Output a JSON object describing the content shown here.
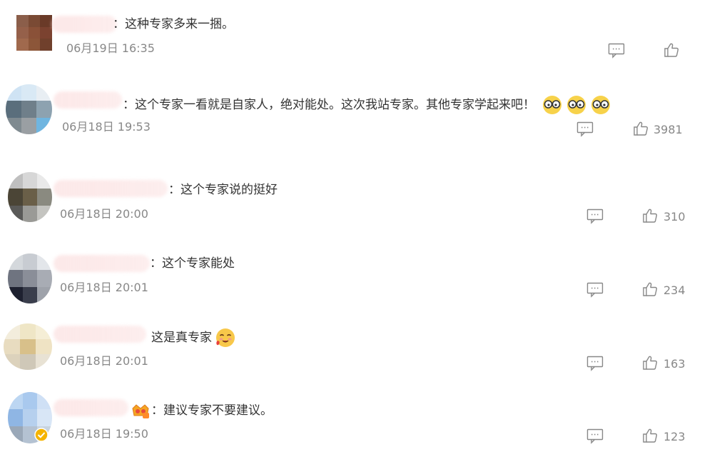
{
  "comments": [
    {
      "text": "：这种专家多来一捆。",
      "time": "06月19日 16:35",
      "likes": "",
      "colors": [
        "#8b5e4a",
        "#7a4a34",
        "#6a3a28",
        "#95604a",
        "#8a5138",
        "#7b4230",
        "#a0694d",
        "#8c5639",
        "#70402c"
      ]
    },
    {
      "text": "：这个专家一看就是自家人，绝对能处。这次我站专家。其他专家学起来吧！",
      "time": "06月18日 19:53",
      "likes": "3981",
      "emojis": [
        "glasses-emoji",
        "glasses-emoji",
        "glasses-emoji"
      ],
      "colors": [
        "#cfe3f4",
        "#d9e9f5",
        "#e8eef3",
        "#5a6e7c",
        "#6f7f8a",
        "#8da2b0",
        "#7f8a90",
        "#9a9fa3",
        "#6fb5e0"
      ]
    },
    {
      "text": "：这个专家说的挺好",
      "time": "06月18日 20:00",
      "likes": "310",
      "colors": [
        "#bfbfbf",
        "#d7d7d7",
        "#e9e9e9",
        "#4b4536",
        "#6a5f48",
        "#8a8a80",
        "#5a5a58",
        "#9a9a96",
        "#c4c4c0"
      ]
    },
    {
      "text": "：这个专家能处",
      "time": "06月18日 20:01",
      "likes": "234",
      "colors": [
        "#d4d8dc",
        "#c8ccd2",
        "#e3e6ea",
        "#6f7480",
        "#8a8e98",
        "#a8acb4",
        "#1e2130",
        "#3a3e4c",
        "#9ea2aa"
      ]
    },
    {
      "text": "这是真专家",
      "time": "06月18日 20:01",
      "likes": "163",
      "emojis": [
        "drool-emoji"
      ],
      "colors": [
        "#f3eddc",
        "#efe6c6",
        "#f5eed6",
        "#e8dcc0",
        "#d8c08a",
        "#efe3c4",
        "#dcd2bc",
        "#cfc8b8",
        "#e8e2d4"
      ]
    },
    {
      "text": "：建议专家不要建议。",
      "time": "06月18日 19:50",
      "likes": "123",
      "colors": [
        "#bcd6f2",
        "#a9c9ee",
        "#cfe0f5",
        "#8fb6e4",
        "#b6d0ee",
        "#d8e6f6",
        "#9aa8b8",
        "#b4c2d2",
        "#c8d4e0"
      ]
    }
  ]
}
